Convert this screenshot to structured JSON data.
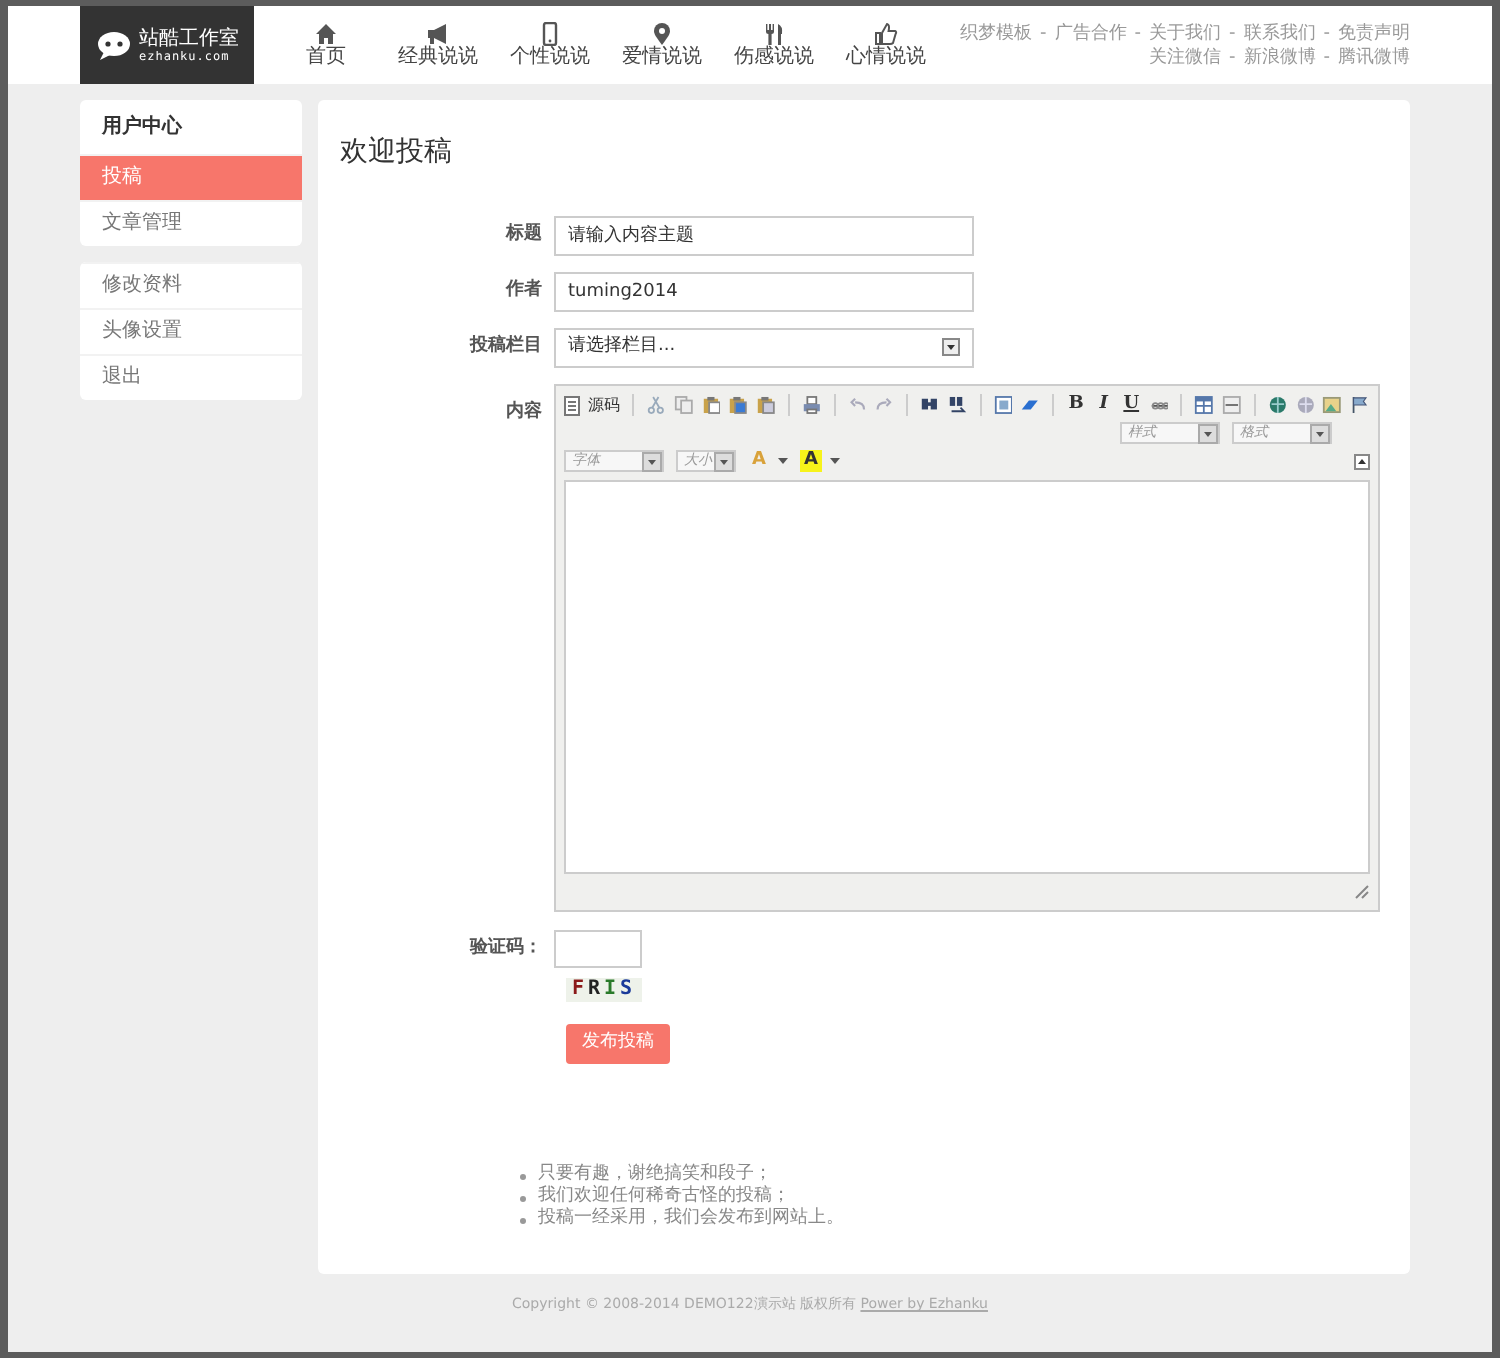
{
  "header": {
    "logo": {
      "title": "站酷工作室",
      "subtitle": "ezhanku.com"
    },
    "nav": [
      {
        "label": "首页",
        "kind": "home"
      },
      {
        "label": "经典说说",
        "kind": "megaphone"
      },
      {
        "label": "个性说说",
        "kind": "phone"
      },
      {
        "label": "爱情说说",
        "kind": "pin"
      },
      {
        "label": "伤感说说",
        "kind": "cutlery"
      },
      {
        "label": "心情说说",
        "kind": "thumb"
      }
    ],
    "links": [
      [
        "织梦模板",
        "广告合作",
        "关于我们",
        "联系我们",
        "免责声明"
      ],
      [
        "关注微信",
        "新浪微博",
        "腾讯微博"
      ]
    ],
    "separator": "-"
  },
  "sidebar": {
    "groups": [
      {
        "heading": "用户中心",
        "items": [
          {
            "label": "投稿",
            "selected": true
          },
          {
            "label": "文章管理",
            "selected": false
          }
        ]
      },
      {
        "items": [
          {
            "label": "修改资料",
            "selected": false
          },
          {
            "label": "头像设置",
            "selected": false
          },
          {
            "label": "退出",
            "selected": false
          }
        ]
      }
    ]
  },
  "main": {
    "title": "欢迎投稿",
    "fields": [
      {
        "kind": "text",
        "label": "标题",
        "value": "请输入内容主题"
      },
      {
        "kind": "text",
        "label": "作者",
        "value": "tuming2014"
      },
      {
        "kind": "select",
        "label": "投稿栏目",
        "value": "请选择栏目..."
      }
    ],
    "editor": {
      "label": "内容",
      "source": "源码",
      "format_buttons": [
        "B",
        "I",
        "U"
      ],
      "combos_row1": [
        "样式",
        "格式"
      ],
      "combos_row2": [
        "字体",
        "大小"
      ],
      "color_buttons": [
        "A",
        "A"
      ]
    },
    "captcha": {
      "label": "验证码：",
      "code": "FRIS"
    },
    "submit": "发布投稿",
    "notes": [
      "只要有趣，谢绝搞笑和段子；",
      "我们欢迎任何稀奇古怪的投稿；",
      "投稿一经采用，我们会发布到网站上。"
    ]
  },
  "footer": {
    "text": "Copyright © 2008-2014 DEMO122演示站 版权所有",
    "link": "Power by Ezhanku"
  }
}
